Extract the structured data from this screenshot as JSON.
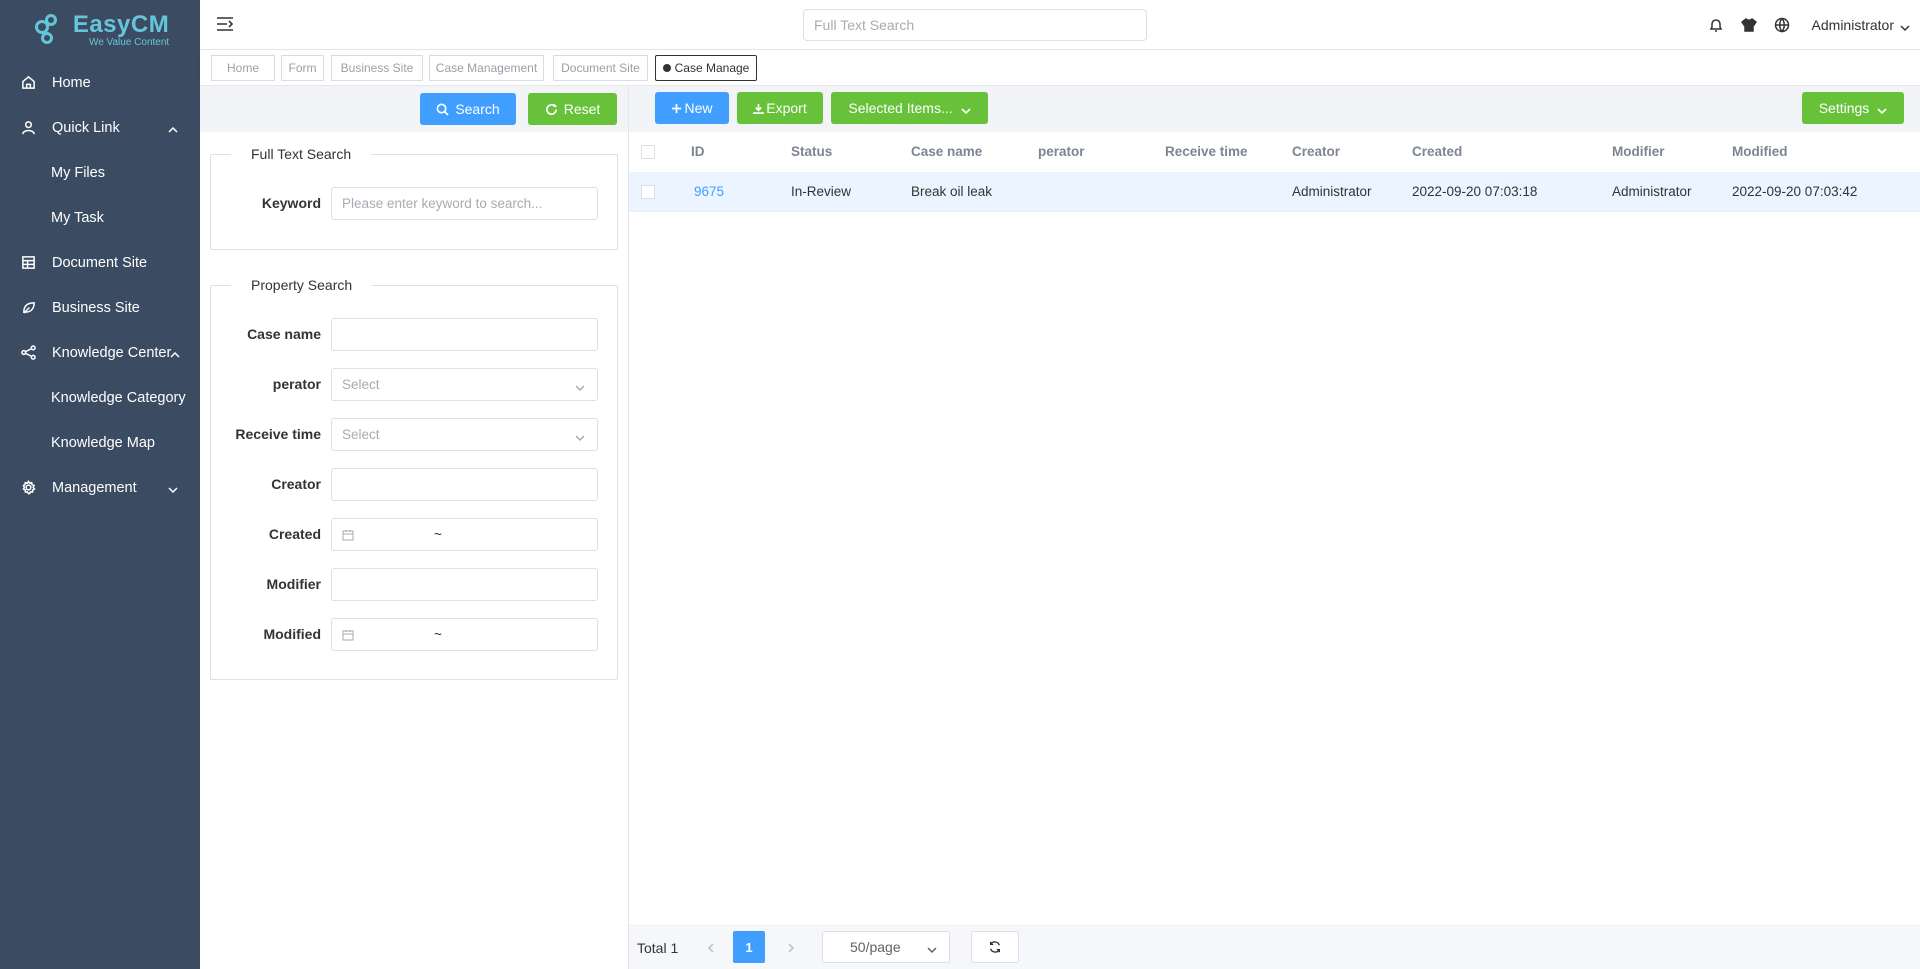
{
  "app": {
    "logo_title": "EasyCM",
    "logo_subtitle": "We Value Content",
    "brand_color": "#67c5d9"
  },
  "sidebar": {
    "items": [
      {
        "label": "Home",
        "icon": "home-icon"
      },
      {
        "label": "Quick Link",
        "icon": "user-icon",
        "expanded": true
      },
      {
        "label": "My Files",
        "sub": true
      },
      {
        "label": "My Task",
        "sub": true
      },
      {
        "label": "Document Site",
        "icon": "document-icon"
      },
      {
        "label": "Business Site",
        "icon": "leaf-icon"
      },
      {
        "label": "Knowledge Center",
        "icon": "share-icon",
        "expanded": true
      },
      {
        "label": "Knowledge Category",
        "sub": true
      },
      {
        "label": "Knowledge Map",
        "sub": true
      },
      {
        "label": "Management",
        "icon": "gear-icon",
        "expanded": false
      }
    ]
  },
  "header": {
    "search_placeholder": "Full Text Search",
    "user": "Administrator"
  },
  "tags": [
    {
      "label": "Home"
    },
    {
      "label": "Form"
    },
    {
      "label": "Business Site"
    },
    {
      "label": "Case Management"
    },
    {
      "label": "Document Site"
    },
    {
      "label": "Case Manage",
      "active": true
    }
  ],
  "left": {
    "search_label": "Search",
    "reset_label": "Reset",
    "fulltext_legend": "Full Text Search",
    "keyword_label": "Keyword",
    "keyword_placeholder": "Please enter keyword to search...",
    "property_legend": "Property Search",
    "fields": {
      "case_name": "Case name",
      "perator": "perator",
      "perator_placeholder": "Select",
      "receive_time": "Receive time",
      "receive_time_placeholder": "Select",
      "creator": "Creator",
      "created": "Created",
      "modifier": "Modifier",
      "modified": "Modified",
      "range_sep": "~"
    }
  },
  "toolbar": {
    "new_label": "New",
    "export_label": "Export",
    "selected_items_label": "Selected Items...",
    "settings_label": "Settings"
  },
  "table": {
    "columns": [
      "ID",
      "Status",
      "Case name",
      "perator",
      "Receive time",
      "Creator",
      "Created",
      "Modifier",
      "Modified"
    ],
    "rows": [
      {
        "id": "9675",
        "status": "In-Review",
        "case_name": "Break oil leak",
        "perator": "",
        "receive_time": "",
        "creator": "Administrator",
        "created": "2022-09-20 07:03:18",
        "modifier": "Administrator",
        "modified": "2022-09-20 07:03:42"
      }
    ]
  },
  "pagination": {
    "total_label": "Total 1",
    "current_page": "1",
    "page_size": "50/page"
  }
}
